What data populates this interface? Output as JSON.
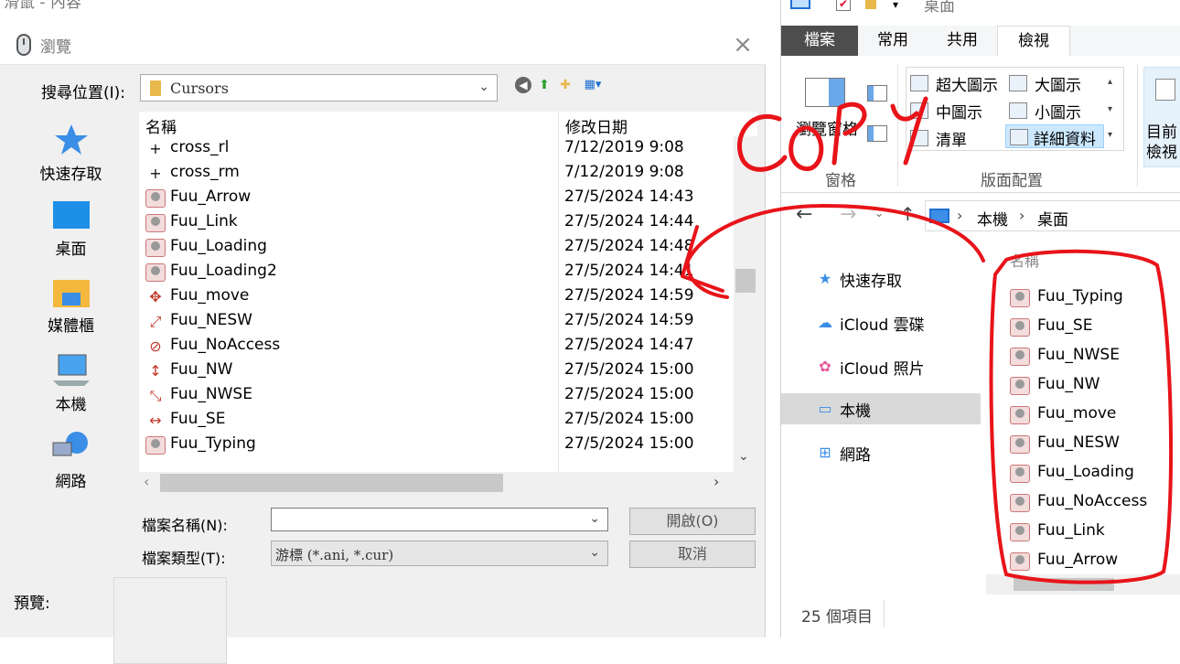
{
  "background_window": {
    "title": "滑鼠 - 內容"
  },
  "dialog": {
    "title": "瀏覽",
    "look_in_label": "搜尋位置(I):",
    "look_in_value": "Cursors",
    "places": [
      {
        "label": "快速存取",
        "icon": "star-icon"
      },
      {
        "label": "桌面",
        "icon": "desktop-icon"
      },
      {
        "label": "媒體櫃",
        "icon": "libraries-icon"
      },
      {
        "label": "本機",
        "icon": "computer-icon"
      },
      {
        "label": "網路",
        "icon": "network-icon"
      }
    ],
    "columns": {
      "name": "名稱",
      "date": "修改日期"
    },
    "files": [
      {
        "name": "cross_rl",
        "date": "7/12/2019 9:08",
        "icon": "crosshair"
      },
      {
        "name": "cross_rm",
        "date": "7/12/2019 9:08",
        "icon": "crosshair"
      },
      {
        "name": "Fuu_Arrow",
        "date": "27/5/2024 14:43",
        "icon": "cursor"
      },
      {
        "name": "Fuu_Link",
        "date": "27/5/2024 14:44",
        "icon": "cursor"
      },
      {
        "name": "Fuu_Loading",
        "date": "27/5/2024 14:48",
        "icon": "cursor"
      },
      {
        "name": "Fuu_Loading2",
        "date": "27/5/2024 14:41",
        "icon": "cursor"
      },
      {
        "name": "Fuu_move",
        "date": "27/5/2024 14:59",
        "icon": "move"
      },
      {
        "name": "Fuu_NESW",
        "date": "27/5/2024 14:59",
        "icon": "resize-nesw"
      },
      {
        "name": "Fuu_NoAccess",
        "date": "27/5/2024 14:47",
        "icon": "no-access"
      },
      {
        "name": "Fuu_NW",
        "date": "27/5/2024 15:00",
        "icon": "resize-ns"
      },
      {
        "name": "Fuu_NWSE",
        "date": "27/5/2024 15:00",
        "icon": "resize-nwse"
      },
      {
        "name": "Fuu_SE",
        "date": "27/5/2024 15:00",
        "icon": "resize-we"
      },
      {
        "name": "Fuu_Typing",
        "date": "27/5/2024 15:00",
        "icon": "cursor"
      }
    ],
    "filename_label": "檔案名稱(N):",
    "filename_value": "",
    "filetype_label": "檔案類型(T):",
    "filetype_value": "游標 (*.ani, *.cur)",
    "open_button": "開啟(O)",
    "cancel_button": "取消",
    "preview_label": "預覽:"
  },
  "explorer": {
    "title": "桌面",
    "tabs": {
      "file": "檔案",
      "home": "常用",
      "share": "共用",
      "view": "檢視"
    },
    "ribbon": {
      "preview_pane": "瀏覽窗格",
      "panes_group": "窗格",
      "layout_group": "版面配置",
      "layout_items": {
        "extra_large": "超大圖示",
        "large": "大圖示",
        "medium": "中圖示",
        "small": "小圖示",
        "list": "清單",
        "details": "詳細資料"
      },
      "current_view": "目前\n檢視"
    },
    "address": {
      "pc": "本機",
      "desktop": "桌面"
    },
    "nav": [
      {
        "label": "快速存取",
        "icon": "star-icon"
      },
      {
        "label": "iCloud 雲碟",
        "icon": "cloud-icon"
      },
      {
        "label": "iCloud 照片",
        "icon": "photos-icon"
      },
      {
        "label": "本機",
        "icon": "computer-icon"
      },
      {
        "label": "網路",
        "icon": "network-icon"
      }
    ],
    "column_name": "名稱",
    "files": [
      {
        "name": "Fuu_Typing"
      },
      {
        "name": "Fuu_SE"
      },
      {
        "name": "Fuu_NWSE"
      },
      {
        "name": "Fuu_NW"
      },
      {
        "name": "Fuu_move"
      },
      {
        "name": "Fuu_NESW"
      },
      {
        "name": "Fuu_Loading"
      },
      {
        "name": "Fuu_NoAccess"
      },
      {
        "name": "Fuu_Link"
      },
      {
        "name": "Fuu_Arrow"
      }
    ],
    "status": "25 個項目"
  },
  "annotation": {
    "text": "COPY",
    "color": "#e8141a"
  },
  "colors": {
    "accent": "#1f6fd1",
    "selection": "#cce8ff",
    "file_tab": "#4d4d4d"
  }
}
